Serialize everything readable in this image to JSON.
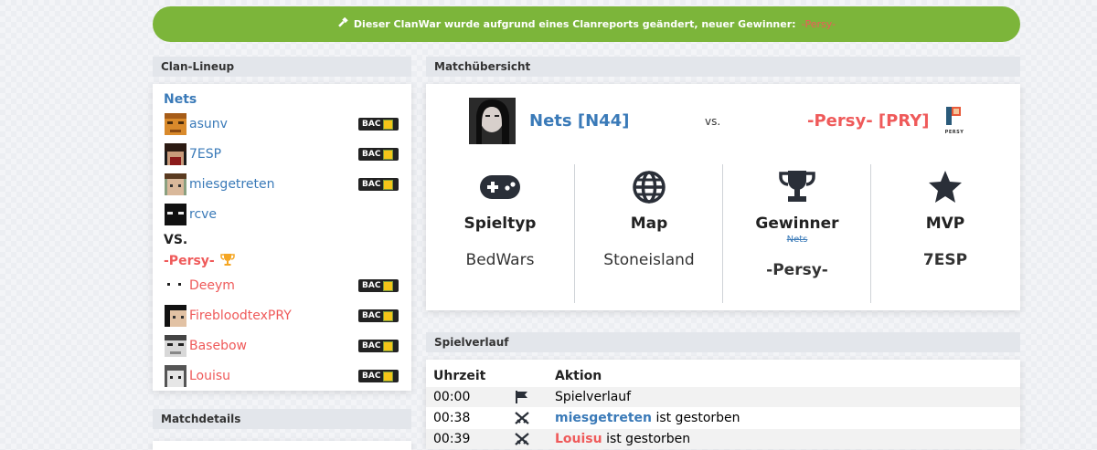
{
  "banner": {
    "icon": "hammer-icon",
    "message": "Dieser ClanWar wurde aufgrund eines Clanreports geändert, neuer Gewinner:",
    "winner": "-Persy-",
    "color": "#7cb53a"
  },
  "lineup": {
    "title": "Clan-Lineup",
    "vs": "VS.",
    "team1": {
      "name": "Nets",
      "players": [
        {
          "name": "asunv",
          "badge": "BAC"
        },
        {
          "name": "7ESP",
          "badge": "BAC"
        },
        {
          "name": "miesgetreten",
          "badge": "BAC"
        },
        {
          "name": "rcve",
          "badge": ""
        }
      ]
    },
    "team2": {
      "name": "-Persy-",
      "trophy_icon": "trophy-icon",
      "players": [
        {
          "name": "Deeym",
          "badge": "BAC"
        },
        {
          "name": "FirebloodtexPRY",
          "badge": "BAC"
        },
        {
          "name": "Basebow",
          "badge": "BAC"
        },
        {
          "name": "Louisu",
          "badge": "BAC"
        }
      ]
    }
  },
  "matchdetails": {
    "title": "Matchdetails"
  },
  "overview": {
    "title": "Matchübersicht",
    "team1": "Nets [N44]",
    "vs": "vs.",
    "team2": "-Persy- [PRY]",
    "team2_logo_text": "PERSY",
    "stats": [
      {
        "icon": "gamepad-icon",
        "label": "Spieltyp",
        "value": "BedWars"
      },
      {
        "icon": "globe-icon",
        "label": "Map",
        "value": "Stoneisland"
      },
      {
        "icon": "trophy-icon",
        "label": "Gewinner",
        "old": "Nets",
        "value": "-Persy-"
      },
      {
        "icon": "star-icon",
        "label": "MVP",
        "value": "7ESP"
      }
    ]
  },
  "history": {
    "title": "Spielverlauf",
    "headers": {
      "time": "Uhrzeit",
      "action": "Aktion"
    },
    "rows": [
      {
        "time": "00:00",
        "icon": "flag-icon",
        "player": "",
        "text": "Spielverlauf"
      },
      {
        "time": "00:38",
        "icon": "crossed-swords-icon",
        "player": "miesgetreten",
        "text": "ist gestorben"
      },
      {
        "time": "00:39",
        "icon": "crossed-swords-icon",
        "player": "Louisu",
        "text": "ist gestorben"
      }
    ]
  },
  "colors": {
    "team1": "#3a7ab8",
    "team2": "#ef5a5a",
    "banner": "#7cb53a"
  }
}
